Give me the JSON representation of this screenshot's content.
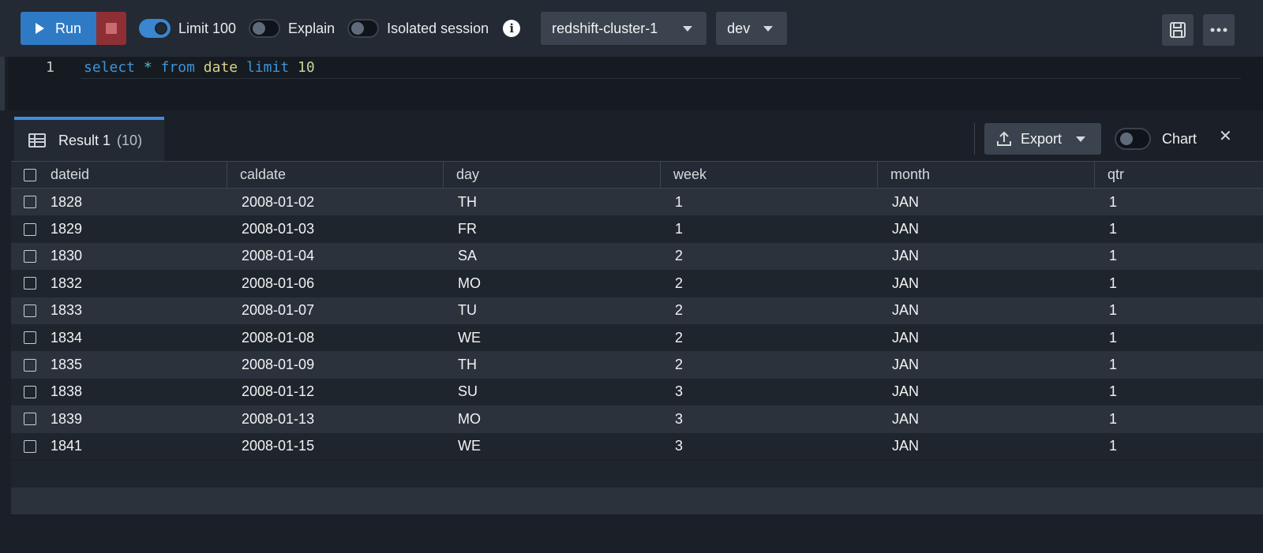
{
  "toolbar": {
    "run_label": "Run",
    "limit_label": "Limit 100",
    "limit_enabled": true,
    "explain_label": "Explain",
    "explain_enabled": false,
    "isolated_label": "Isolated session",
    "isolated_enabled": false,
    "cluster": "redshift-cluster-1",
    "database": "dev"
  },
  "editor": {
    "line_number": "1",
    "tokens": {
      "select": "select",
      "star": "*",
      "from": "from",
      "table": "date",
      "limit": "limit",
      "count": "10"
    }
  },
  "result": {
    "tab_label": "Result 1",
    "tab_count": "(10)",
    "export_label": "Export",
    "chart_label": "Chart",
    "chart_enabled": false,
    "columns": [
      "dateid",
      "caldate",
      "day",
      "week",
      "month",
      "qtr"
    ],
    "rows": [
      [
        "1828",
        "2008-01-02",
        "TH",
        "1",
        "JAN",
        "1"
      ],
      [
        "1829",
        "2008-01-03",
        "FR",
        "1",
        "JAN",
        "1"
      ],
      [
        "1830",
        "2008-01-04",
        "SA",
        "2",
        "JAN",
        "1"
      ],
      [
        "1832",
        "2008-01-06",
        "MO",
        "2",
        "JAN",
        "1"
      ],
      [
        "1833",
        "2008-01-07",
        "TU",
        "2",
        "JAN",
        "1"
      ],
      [
        "1834",
        "2008-01-08",
        "WE",
        "2",
        "JAN",
        "1"
      ],
      [
        "1835",
        "2008-01-09",
        "TH",
        "2",
        "JAN",
        "1"
      ],
      [
        "1838",
        "2008-01-12",
        "SU",
        "3",
        "JAN",
        "1"
      ],
      [
        "1839",
        "2008-01-13",
        "MO",
        "3",
        "JAN",
        "1"
      ],
      [
        "1841",
        "2008-01-15",
        "WE",
        "3",
        "JAN",
        "1"
      ]
    ]
  },
  "colors": {
    "run_button": "#2f7ac4",
    "stop_button": "#8d2f35",
    "toggle_on": "#3a86d0",
    "tab_accent": "#3c8ee0"
  },
  "icons": [
    "play-icon",
    "stop-icon",
    "info-icon",
    "chevron-down-icon",
    "save-icon",
    "more-icon",
    "table-icon",
    "upload-icon",
    "close-icon"
  ]
}
